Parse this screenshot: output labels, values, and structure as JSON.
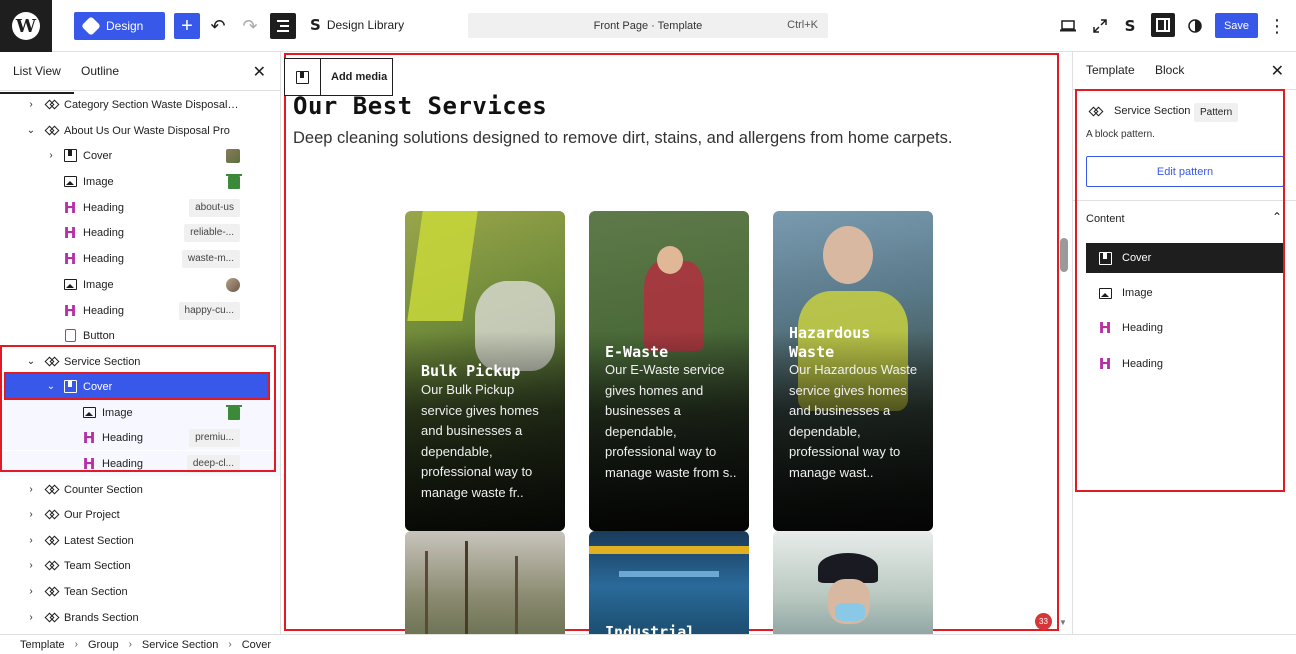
{
  "topbar": {
    "design_label": "Design",
    "design_library_label": "Design Library",
    "command_bar_text": "Front Page · Template",
    "command_shortcut": "Ctrl+K",
    "save_label": "Save",
    "accent_color": "#3858e9"
  },
  "left_panel": {
    "tabs": [
      {
        "label": "List View"
      },
      {
        "label": "Outline"
      }
    ],
    "close_icon": "close-icon",
    "tree": [
      {
        "label": "Category Section Waste Disposal ...",
        "icon": "pattern-icon"
      },
      {
        "label": "About Us Our Waste Disposal Pro",
        "icon": "pattern-icon"
      },
      {
        "label": "Cover",
        "icon": "cover-icon"
      },
      {
        "label": "Image",
        "icon": "image-icon"
      },
      {
        "label": "Heading",
        "icon": "heading-icon",
        "tag": "about-us"
      },
      {
        "label": "Heading",
        "icon": "heading-icon",
        "tag": "reliable-..."
      },
      {
        "label": "Heading",
        "icon": "heading-icon",
        "tag": "waste-m..."
      },
      {
        "label": "Image",
        "icon": "image-icon"
      },
      {
        "label": "Heading",
        "icon": "heading-icon",
        "tag": "happy-cu..."
      },
      {
        "label": "Button",
        "icon": "button-icon"
      },
      {
        "label": "Service Section",
        "icon": "pattern-icon"
      },
      {
        "label": "Cover",
        "icon": "cover-icon"
      },
      {
        "label": "Image",
        "icon": "image-icon"
      },
      {
        "label": "Heading",
        "icon": "heading-icon",
        "tag": "premiu..."
      },
      {
        "label": "Heading",
        "icon": "heading-icon",
        "tag": "deep-cl..."
      },
      {
        "label": "Counter Section",
        "icon": "pattern-icon"
      },
      {
        "label": "Our Project",
        "icon": "pattern-icon"
      },
      {
        "label": "Latest Section",
        "icon": "pattern-icon"
      },
      {
        "label": "Team Section",
        "icon": "pattern-icon"
      },
      {
        "label": "Tean Section",
        "icon": "pattern-icon"
      },
      {
        "label": "Brands Section",
        "icon": "pattern-icon"
      }
    ]
  },
  "canvas": {
    "add_media_label": "Add media",
    "section_title": "Our Best Services",
    "section_description": "Deep cleaning solutions designed to remove dirt, stains, and allergens from home carpets.",
    "cards": [
      {
        "title": "Bulk Pickup",
        "description": "Our Bulk Pickup service gives homes and businesses a dependable, professional way to manage waste fr.."
      },
      {
        "title": "E-Waste",
        "description": "Our E-Waste service gives homes and businesses a dependable, professional way to manage waste from s.."
      },
      {
        "title_line1": "Hazardous",
        "title_line2": "Waste",
        "description": "Our Hazardous Waste service gives homes and businesses a dependable, professional way to manage wast.."
      }
    ],
    "second_row": [
      {
        "title": ""
      },
      {
        "title": "Industrial"
      },
      {
        "title": ""
      }
    ],
    "notification_count": "33"
  },
  "right_panel": {
    "tabs": [
      {
        "label": "Template"
      },
      {
        "label": "Block"
      }
    ],
    "block_name": "Service Section",
    "pattern_badge": "Pattern",
    "block_description": "A block pattern.",
    "edit_pattern_label": "Edit pattern",
    "content_header": "Content",
    "content_items": [
      {
        "label": "Cover"
      },
      {
        "label": "Image"
      },
      {
        "label": "Heading"
      },
      {
        "label": "Heading"
      }
    ]
  },
  "breadcrumb": [
    {
      "label": "Template"
    },
    {
      "label": "Group"
    },
    {
      "label": "Service Section"
    },
    {
      "label": "Cover"
    }
  ]
}
